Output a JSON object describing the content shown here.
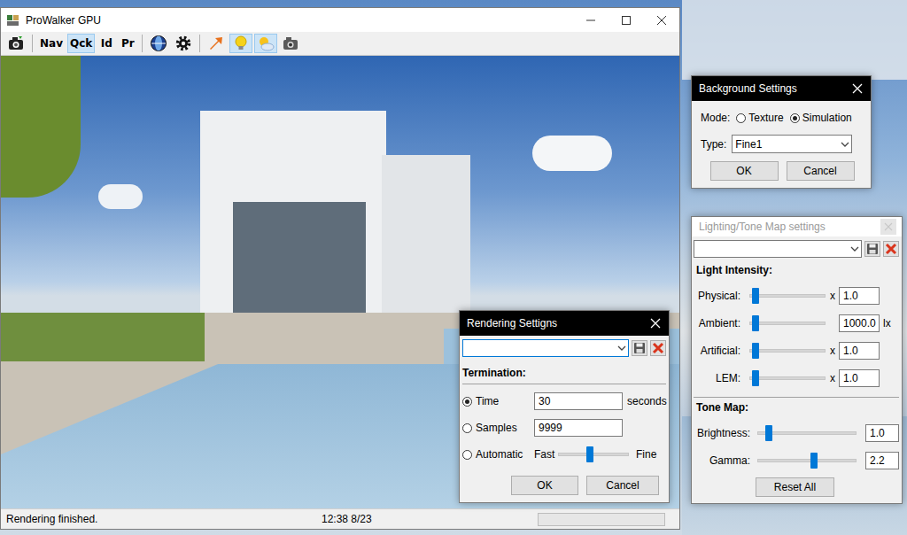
{
  "window": {
    "title": "ProWalker GPU"
  },
  "toolbar": [
    {
      "kind": "icon",
      "selected": false
    },
    {
      "kind": "text",
      "label": "Nav",
      "selected": false
    },
    {
      "kind": "text",
      "label": "Qck",
      "selected": true
    },
    {
      "kind": "text",
      "label": "Id",
      "selected": false
    },
    {
      "kind": "text",
      "label": "Pr",
      "selected": false
    },
    {
      "kind": "icon",
      "selected": false
    },
    {
      "kind": "icon",
      "selected": false
    },
    {
      "kind": "icon",
      "selected": false
    },
    {
      "kind": "icon",
      "selected": true
    },
    {
      "kind": "icon",
      "selected": true
    },
    {
      "kind": "icon",
      "selected": false
    }
  ],
  "status_bar": {
    "message": "Rendering finished.",
    "time": "12:38 8/23",
    "progress": 0
  },
  "rendering_settings": {
    "title": "Rendering Settigns",
    "preset": "",
    "termination_label": "Termination:",
    "options": [
      {
        "kind": "field",
        "label": "Time",
        "selected": true,
        "value": "30",
        "unit": "seconds"
      },
      {
        "kind": "field",
        "label": "Samples",
        "selected": false,
        "value": "9999",
        "unit": ""
      },
      {
        "kind": "slider",
        "label": "Automatic",
        "selected": false,
        "min_label": "Fast",
        "max_label": "Fine",
        "level": 0.45
      }
    ],
    "buttons": [
      "OK",
      "Cancel"
    ]
  },
  "background_settings": {
    "title": "Background Settings",
    "mode_label": "Mode:",
    "modes": [
      {
        "label": "Texture",
        "selected": false
      },
      {
        "label": "Simulation",
        "selected": true
      }
    ],
    "type_label": "Type:",
    "type": "Fine1",
    "buttons": [
      "OK",
      "Cancel"
    ]
  },
  "lighting": {
    "title": "Lighting/Tone Map settings",
    "active": false,
    "preset": "",
    "sections": [
      {
        "heading": "Light Intensity:",
        "rows": [
          {
            "label": "Physical:",
            "level": 0.08,
            "prefix": "x",
            "value": "1.0",
            "suffix": ""
          },
          {
            "label": "Ambient:",
            "level": 0.08,
            "prefix": "",
            "value": "1000.0",
            "suffix": "lx"
          },
          {
            "label": "Artificial:",
            "level": 0.08,
            "prefix": "x",
            "value": "1.0",
            "suffix": ""
          },
          {
            "label": "LEM:",
            "level": 0.08,
            "prefix": "x",
            "value": "1.0",
            "suffix": ""
          }
        ]
      },
      {
        "heading": "Tone Map:",
        "rows": [
          {
            "label": "Brightness:",
            "level": 0.12,
            "prefix": "",
            "value": "1.0",
            "suffix": ""
          },
          {
            "label": "Gamma:",
            "level": 0.57,
            "prefix": "",
            "value": "2.2",
            "suffix": ""
          }
        ]
      }
    ],
    "button": "Reset All"
  }
}
